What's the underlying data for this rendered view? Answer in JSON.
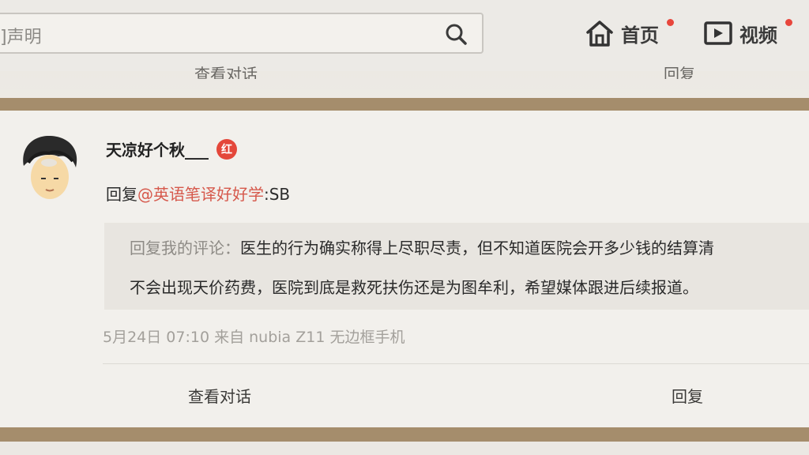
{
  "search": {
    "text": "]声明"
  },
  "nav": {
    "home_label": "首页",
    "video_label": "视频"
  },
  "previous_item": {
    "view_conversation": "查看对话",
    "reply": "回复"
  },
  "comment": {
    "username": "天凉好个秋___",
    "badge_text": "红",
    "reply_prefix": "回复",
    "reply_mention": "@英语笔译好好学",
    "reply_text": ":SB",
    "quote_prefix": "回复我的评论：",
    "quote_line1": "医生的行为确实称得上尽职尽责，但不知道医院会开多少钱的结算清",
    "quote_line2": "不会出现天价药费，医院到底是救死扶伤还是为图牟利，希望媒体跟进后续报道。",
    "meta": "5月24日 07:10 来自 nubia Z11 无边框手机",
    "view_conversation": "查看对话",
    "reply": "回复"
  },
  "colors": {
    "separator": "#a58d6c",
    "mention": "#d6594c",
    "notification_dot": "#e8463c",
    "badge": "#e4473a"
  }
}
